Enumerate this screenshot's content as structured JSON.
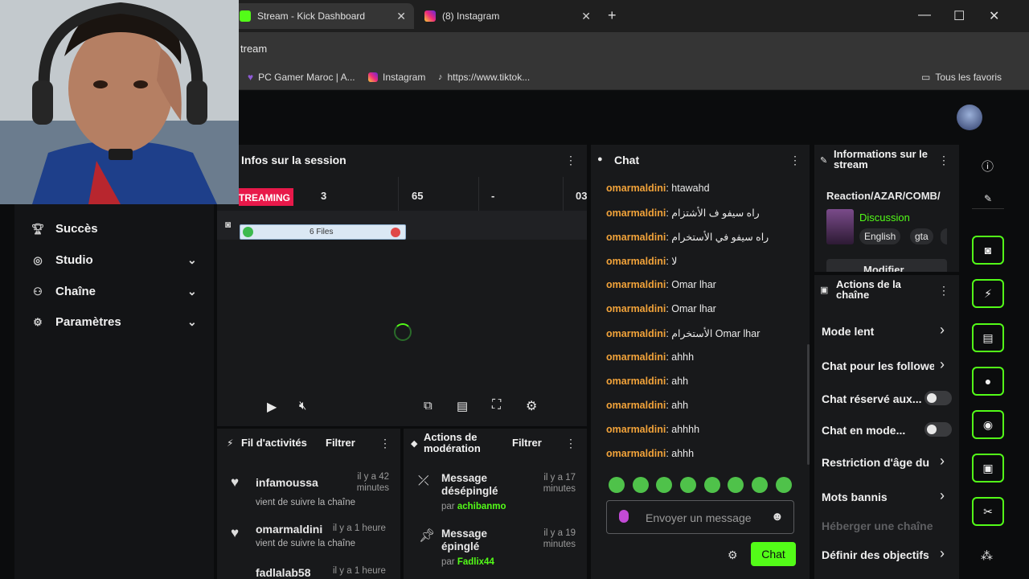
{
  "browser": {
    "tabs": [
      {
        "title": "Stream - Kick Dashboard",
        "active": true
      },
      {
        "title": "(8) Instagram",
        "active": false
      }
    ],
    "address": "tream",
    "bookmarks": [
      "PC Gamer Maroc | A...",
      "Instagram",
      "https://www.tiktok..."
    ],
    "all_bookmarks": "Tous les favoris"
  },
  "sidebar": {
    "items": [
      {
        "label": "Succès",
        "icon": "trophy-icon",
        "expandable": false
      },
      {
        "label": "Studio",
        "icon": "studio-icon",
        "expandable": true
      },
      {
        "label": "Chaîne",
        "icon": "channel-icon",
        "expandable": true
      },
      {
        "label": "Paramètres",
        "icon": "gear-icon",
        "expandable": true
      }
    ]
  },
  "session": {
    "title": "Infos sur la session",
    "status": "TREAMING",
    "stats": [
      "3",
      "65",
      "-",
      "03"
    ],
    "notification": "6 Files"
  },
  "activity": {
    "title": "Fil d'activités",
    "filter": "Filtrer",
    "items": [
      {
        "user": "infamoussa",
        "text": "vient de suivre la chaîne",
        "time": "il y a 42 minutes"
      },
      {
        "user": "omarmaldini",
        "text": "vient de suivre la chaîne",
        "time": "il y a 1 heure"
      },
      {
        "user": "fadlalab58",
        "text": "",
        "time": "il y a 1 heure"
      }
    ]
  },
  "moderation": {
    "title": "Actions de modération",
    "filter": "Filtrer",
    "items": [
      {
        "action": "Message désépinglé",
        "by_prefix": "par",
        "by": "achibanmo",
        "time": "il y a 17 minutes"
      },
      {
        "action": "Message épinglé",
        "by_prefix": "par",
        "by": "Fadlix44",
        "time": "il y a 19 minutes"
      }
    ]
  },
  "chat": {
    "title": "Chat",
    "user": "omarmaldini",
    "messages": [
      "htawahd",
      "راه سيفو ف الأشتزام",
      "راه سيفو في الأستخرام",
      "لا",
      "Omar lhar",
      "Omar lhar",
      "الأستخرام Omar lhar",
      "ahhh",
      "ahh",
      "ahh",
      "ahhhh",
      "ahhh"
    ],
    "placeholder": "Envoyer un message",
    "send_label": "Chat"
  },
  "stream_info": {
    "title": "Informations sur le stream",
    "stream_title": "Reaction/AZAR/COMB/",
    "category": "Discussion",
    "tags": [
      "English",
      "gta"
    ],
    "edit_label": "Modifier"
  },
  "channel_actions": {
    "title": "Actions de la chaîne",
    "items": [
      {
        "label": "Mode lent",
        "type": "chevron"
      },
      {
        "label": "Chat pour les followe",
        "type": "chevron"
      },
      {
        "label": "Chat réservé aux...",
        "type": "toggle"
      },
      {
        "label": "Chat en mode...",
        "type": "toggle"
      },
      {
        "label": "Restriction d'âge du",
        "type": "chevron"
      },
      {
        "label": "Mots bannis",
        "type": "chevron"
      },
      {
        "label": "Héberger une chaîne",
        "type": "disabled"
      },
      {
        "label": "Définir des objectifs",
        "type": "chevron"
      }
    ]
  },
  "colors": {
    "accent": "#53fc18",
    "username": "#f2a33a",
    "live": "#e8194a"
  }
}
